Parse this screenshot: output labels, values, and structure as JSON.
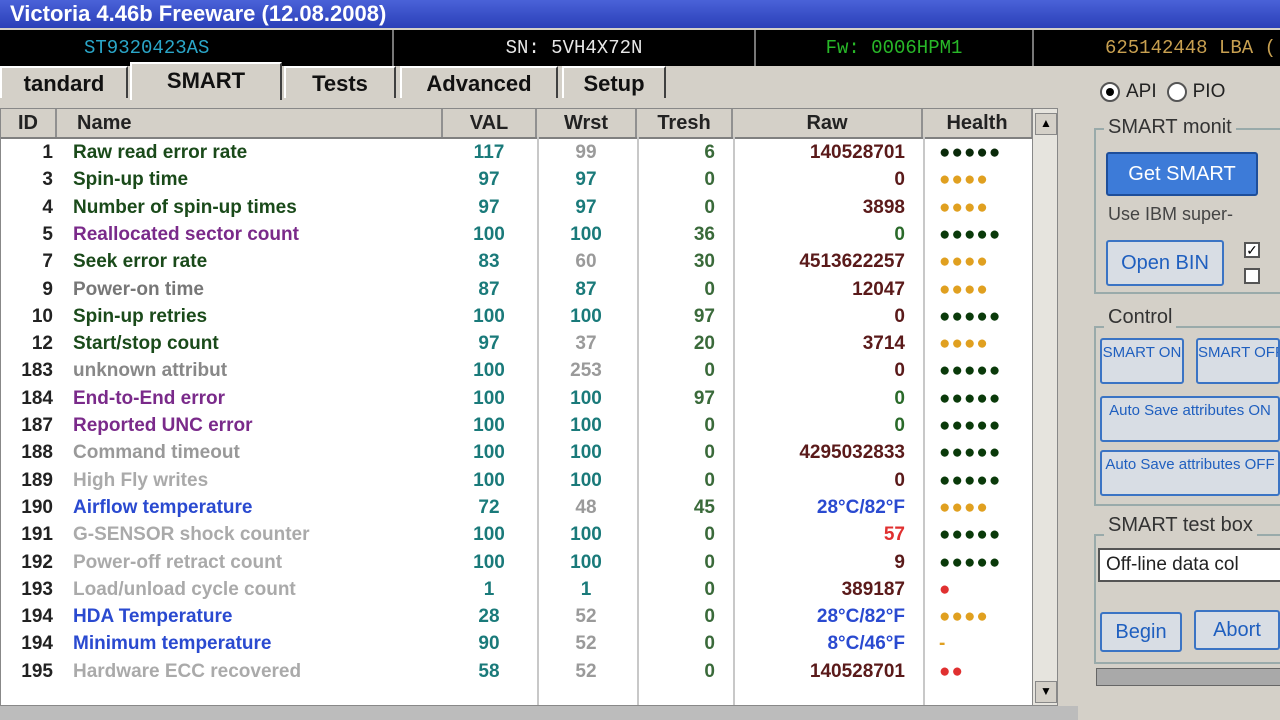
{
  "window": {
    "title": "Victoria 4.46b Freeware (12.08.2008)"
  },
  "infobar": {
    "model": "ST9320423AS",
    "serial": "SN: 5VH4X72N",
    "firmware": "Fw: 0006HPM1",
    "lba": "625142448 LBA ("
  },
  "tabs": [
    "tandard",
    "SMART",
    "Tests",
    "Advanced",
    "Setup"
  ],
  "mode": {
    "api": "API",
    "pio": "PIO"
  },
  "table": {
    "columns": {
      "id": "ID",
      "name": "Name",
      "val": "VAL",
      "wrst": "Wrst",
      "tresh": "Tresh",
      "raw": "Raw",
      "health": "Health"
    },
    "rows": [
      {
        "id": "1",
        "name": "Raw read error rate",
        "val": "117",
        "wrst": "99",
        "tresh": "6",
        "raw": "140528701",
        "health": "●●●●●",
        "name_color": "#1a4a1a",
        "raw_color": "#5a1a1a",
        "health_color": "#0a2a0a"
      },
      {
        "id": "3",
        "name": "Spin-up time",
        "val": "97",
        "wrst": "97",
        "tresh": "0",
        "raw": "0",
        "health": "●●●●",
        "name_color": "#1a4a1a",
        "raw_color": "#5a1a1a",
        "health_color": "#e0a020"
      },
      {
        "id": "4",
        "name": "Number of spin-up times",
        "val": "97",
        "wrst": "97",
        "tresh": "0",
        "raw": "3898",
        "health": "●●●●",
        "name_color": "#1a4a1a",
        "raw_color": "#5a1a1a",
        "health_color": "#e0a020"
      },
      {
        "id": "5",
        "name": "Reallocated sector count",
        "val": "100",
        "wrst": "100",
        "tresh": "36",
        "raw": "0",
        "health": "●●●●●",
        "name_color": "#7a2a8a",
        "raw_color": "#2a6a2a",
        "health_color": "#0a3a0a"
      },
      {
        "id": "7",
        "name": "Seek error rate",
        "val": "83",
        "wrst": "60",
        "tresh": "30",
        "raw": "4513622257",
        "health": "●●●●",
        "name_color": "#1a4a1a",
        "raw_color": "#5a1a1a",
        "health_color": "#e0a020"
      },
      {
        "id": "9",
        "name": "Power-on time",
        "val": "87",
        "wrst": "87",
        "tresh": "0",
        "raw": "12047",
        "health": "●●●●",
        "name_color": "#777777",
        "raw_color": "#5a1a1a",
        "health_color": "#e0a020"
      },
      {
        "id": "10",
        "name": "Spin-up retries",
        "val": "100",
        "wrst": "100",
        "tresh": "97",
        "raw": "0",
        "health": "●●●●●",
        "name_color": "#1a4a1a",
        "raw_color": "#5a1a1a",
        "health_color": "#0a3a0a"
      },
      {
        "id": "12",
        "name": "Start/stop count",
        "val": "97",
        "wrst": "37",
        "tresh": "20",
        "raw": "3714",
        "health": "●●●●",
        "name_color": "#1a4a1a",
        "raw_color": "#5a1a1a",
        "health_color": "#e0a020"
      },
      {
        "id": "183",
        "name": "unknown attribut",
        "val": "100",
        "wrst": "253",
        "tresh": "0",
        "raw": "0",
        "health": "●●●●●",
        "name_color": "#888888",
        "raw_color": "#5a1a1a",
        "health_color": "#0a3a0a"
      },
      {
        "id": "184",
        "name": "End-to-End error",
        "val": "100",
        "wrst": "100",
        "tresh": "97",
        "raw": "0",
        "health": "●●●●●",
        "name_color": "#7a2a8a",
        "raw_color": "#2a6a2a",
        "health_color": "#0a3a0a"
      },
      {
        "id": "187",
        "name": "Reported UNC error",
        "val": "100",
        "wrst": "100",
        "tresh": "0",
        "raw": "0",
        "health": "●●●●●",
        "name_color": "#7a2a8a",
        "raw_color": "#2a6a2a",
        "health_color": "#0a3a0a"
      },
      {
        "id": "188",
        "name": "Command timeout",
        "val": "100",
        "wrst": "100",
        "tresh": "0",
        "raw": "4295032833",
        "health": "●●●●●",
        "name_color": "#999999",
        "raw_color": "#5a1a1a",
        "health_color": "#0a3a0a"
      },
      {
        "id": "189",
        "name": "High Fly writes",
        "val": "100",
        "wrst": "100",
        "tresh": "0",
        "raw": "0",
        "health": "●●●●●",
        "name_color": "#aaaaaa",
        "raw_color": "#5a1a1a",
        "health_color": "#0a3a0a"
      },
      {
        "id": "190",
        "name": "Airflow temperature",
        "val": "72",
        "wrst": "48",
        "tresh": "45",
        "raw": "28°C/82°F",
        "health": "●●●●",
        "name_color": "#2a4ad0",
        "raw_color": "#2a4ad0",
        "health_color": "#e0a020"
      },
      {
        "id": "191",
        "name": "G-SENSOR shock counter",
        "val": "100",
        "wrst": "100",
        "tresh": "0",
        "raw": "57",
        "health": "●●●●●",
        "name_color": "#aaaaaa",
        "raw_color": "#e03030",
        "health_color": "#0a3a0a"
      },
      {
        "id": "192",
        "name": "Power-off retract count",
        "val": "100",
        "wrst": "100",
        "tresh": "0",
        "raw": "9",
        "health": "●●●●●",
        "name_color": "#aaaaaa",
        "raw_color": "#5a1a1a",
        "health_color": "#0a3a0a"
      },
      {
        "id": "193",
        "name": "Load/unload cycle count",
        "val": "1",
        "wrst": "1",
        "tresh": "0",
        "raw": "389187",
        "health": "●",
        "name_color": "#aaaaaa",
        "raw_color": "#5a1a1a",
        "health_color": "#e03030"
      },
      {
        "id": "194",
        "name": "HDA Temperature",
        "val": "28",
        "wrst": "52",
        "tresh": "0",
        "raw": "28°C/82°F",
        "health": "●●●●",
        "name_color": "#2a4ad0",
        "raw_color": "#2a4ad0",
        "health_color": "#e0a020"
      },
      {
        "id": "194",
        "name": "Minimum temperature",
        "val": "90",
        "wrst": "52",
        "tresh": "0",
        "raw": "8°C/46°F",
        "health": "-",
        "name_color": "#2a4ad0",
        "raw_color": "#2a4ad0",
        "health_color": "#e0a020"
      },
      {
        "id": "195",
        "name": "Hardware ECC recovered",
        "val": "58",
        "wrst": "52",
        "tresh": "0",
        "raw": "140528701",
        "health": "●●",
        "name_color": "#aaaaaa",
        "raw_color": "#5a1a1a",
        "health_color": "#e03030"
      }
    ]
  },
  "smart_monitor": {
    "label": "SMART monit",
    "get_smart": "Get SMART",
    "ibm_text": "Use IBM super-",
    "open_bin": "Open BIN"
  },
  "control": {
    "label": "Control",
    "smart_on": "SMART ON",
    "smart_off": "SMART OFF",
    "autosave_on": "Auto Save attributes ON",
    "autosave_off": "Auto Save attributes OFF"
  },
  "test_box": {
    "label": "SMART test box",
    "selected": "Off-line data col",
    "begin": "Begin",
    "abort": "Abort"
  },
  "colors": {
    "val_color": "#1a7a7a",
    "wrst_faded": "#9a9a9a",
    "tresh_color": "#3a6a3a"
  }
}
